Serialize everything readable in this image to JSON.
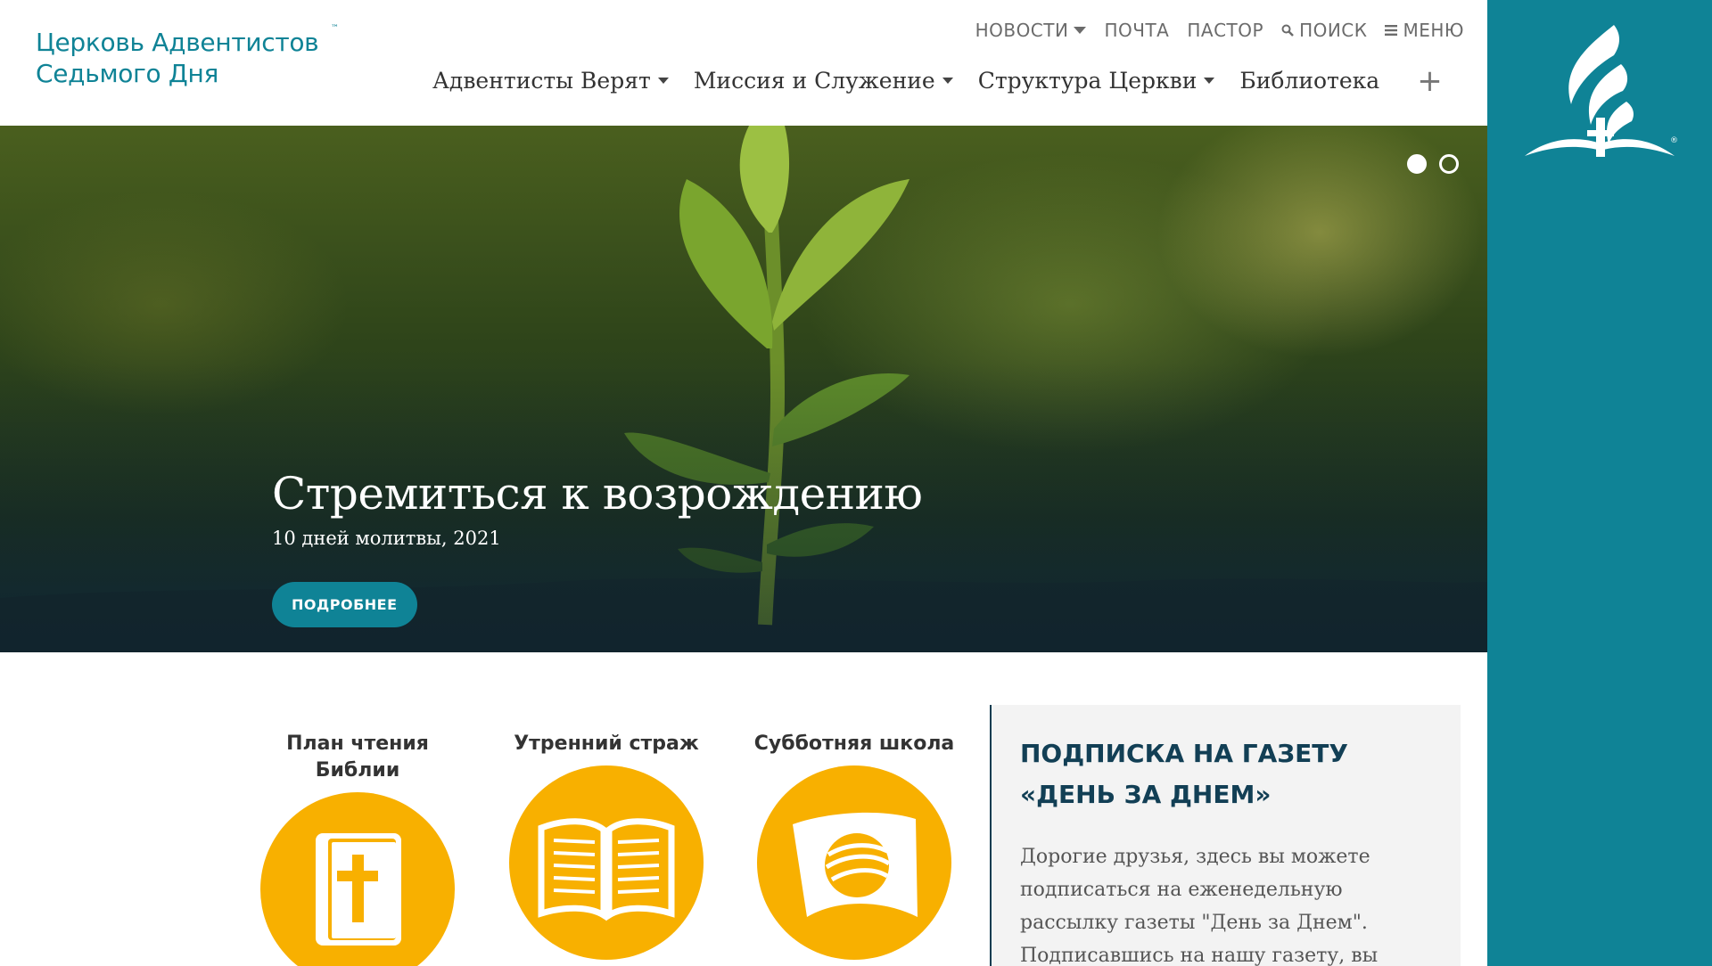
{
  "header": {
    "site_title_line1": "Церковь Адвентистов",
    "site_title_line2": "Седьмого Дня",
    "trademark": "™",
    "utility_nav": {
      "news": "НОВОСТИ",
      "mail": "ПОЧТА",
      "pastor": "ПАСТОР",
      "search": "ПОИСК",
      "menu": "МЕНЮ"
    },
    "main_nav": {
      "beliefs": "Адвентисты Верят",
      "mission": "Миссия и Служение",
      "structure": "Структура Церкви",
      "library": "Библиотека",
      "more": "+"
    }
  },
  "hero": {
    "title": "Стремиться к возрождению",
    "subtitle": "10 дней молитвы, 2021",
    "button_label": "ПОДРОБНЕЕ",
    "slide_count": 2,
    "active_slide": 1
  },
  "quick_links": [
    {
      "label_line1": "План чтения",
      "label_line2": "Библии",
      "icon": "bible-cross-icon"
    },
    {
      "label_line1": "Утренний страж",
      "label_line2": "",
      "icon": "open-book-icon"
    },
    {
      "label_line1": "Субботняя школа",
      "label_line2": "",
      "icon": "sabbath-school-logo-icon"
    }
  ],
  "subscribe": {
    "title": "ПОДПИСКА НА ГАЗЕТУ «ДЕНЬ ЗА ДНЕМ»",
    "text": "Дорогие друзья, здесь вы можете подписаться на еженедельную рассылку газеты \"День за Днем\". Подписавшись на нашу газету, вы"
  },
  "colors": {
    "brand_teal": "#0f8396",
    "accent_yellow": "#f8b000",
    "dark_navy": "#123f55"
  }
}
